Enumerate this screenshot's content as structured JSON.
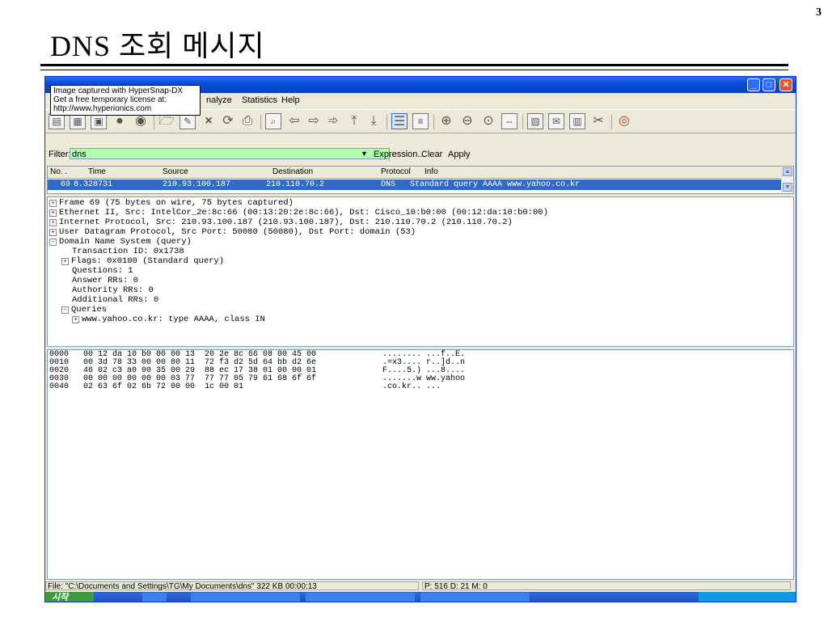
{
  "slide": {
    "title": "DNS 조회 메시지",
    "page_number": "3"
  },
  "tooltip": {
    "line1": "Image captured with HyperSnap-DX",
    "line2": "Get a free temporary license at:",
    "line3": "http://www.hyperionics.com"
  },
  "menu": {
    "analyze": "nalyze",
    "statistics": "Statistics",
    "help": "Help"
  },
  "filter": {
    "label": "Filter:",
    "value": "dns",
    "expression": "Expression...",
    "clear": "Clear",
    "apply": "Apply"
  },
  "packet_list": {
    "headers": {
      "no": "No. .",
      "time": "Time",
      "source": "Source",
      "destination": "Destination",
      "protocol": "Protocol",
      "info": "Info"
    },
    "row": {
      "no": "69",
      "time": "8.328731",
      "source": "210.93.100.187",
      "destination": "210.110.70.2",
      "protocol": "DNS",
      "info": "Standard query AAAA www.yahoo.co.kr"
    }
  },
  "details": [
    {
      "text": "Frame 69 (75 bytes on wire, 75 bytes captured)",
      "toggle": "+"
    },
    {
      "text": "Ethernet II, Src: IntelCor_2e:8c:66 (00:13:20:2e:8c:66), Dst: Cisco_10:b0:00 (00:12:da:10:b0:00)",
      "toggle": "+"
    },
    {
      "text": "Internet Protocol, Src: 210.93.100.187 (210.93.100.187), Dst: 210.110.70.2 (210.110.70.2)",
      "toggle": "+"
    },
    {
      "text": "User Datagram Protocol, Src Port: 50080 (50080), Dst Port: domain (53)",
      "toggle": "+"
    },
    {
      "text": "Domain Name System (query)",
      "toggle": "−"
    },
    {
      "text": "Transaction ID: 0x1738",
      "toggle": ""
    },
    {
      "text": "Flags: 0x0100 (Standard query)",
      "toggle": "+"
    },
    {
      "text": "Questions: 1",
      "toggle": ""
    },
    {
      "text": "Answer RRs: 0",
      "toggle": ""
    },
    {
      "text": "Authority RRs: 0",
      "toggle": ""
    },
    {
      "text": "Additional RRs: 0",
      "toggle": ""
    },
    {
      "text": "Queries",
      "toggle": "−"
    },
    {
      "text": "www.yahoo.co.kr: type AAAA, class IN",
      "toggle": "+"
    }
  ],
  "hex": [
    {
      "offset": "0000",
      "bytes": "00 12 da 10 b0 00 00 13  20 2e 8c 66 08 00 45 00",
      "ascii": "........ ...f..E."
    },
    {
      "offset": "0010",
      "bytes": "00 3d 78 33 00 00 80 11  72 f3 d2 5d 64 bb d2 6e",
      "ascii": ".=x3.... r..]d..n"
    },
    {
      "offset": "0020",
      "bytes": "46 02 c3 a0 00 35 00 29  88 ec 17 38 01 00 00 01",
      "ascii": "F....5.) ...8...."
    },
    {
      "offset": "0030",
      "bytes": "00 00 00 00 00 00 03 77  77 77 05 79 61 68 6f 6f",
      "ascii": ".......w ww.yahoo"
    },
    {
      "offset": "0040",
      "bytes": "02 63 6f 02 6b 72 00 00  1c 00 01",
      "ascii": ".co.kr.. ..."
    }
  ],
  "status": {
    "file": "File: \"C:\\Documents and Settings\\TG\\My Documents\\dns\" 322 KB 00:00:13",
    "packets": "P: 516 D: 21 M: 0"
  },
  "taskbar": {
    "start": "시작"
  }
}
